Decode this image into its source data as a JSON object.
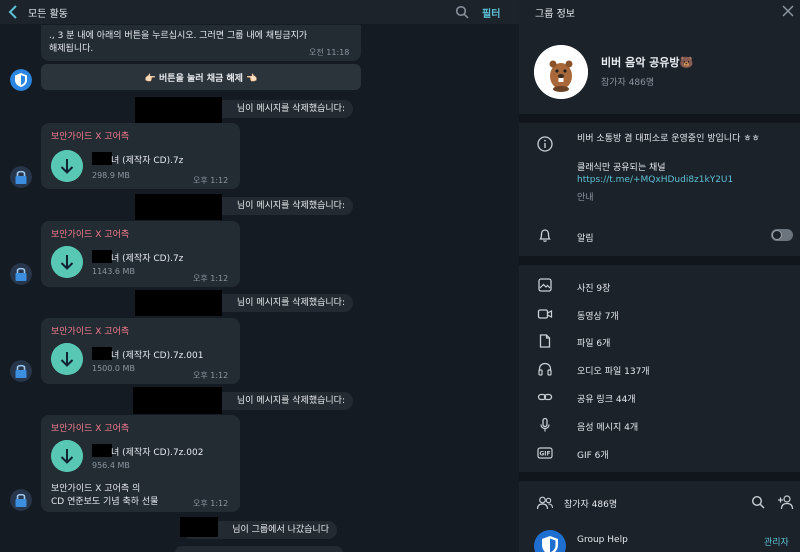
{
  "chat": {
    "header": {
      "title": "모든 활동",
      "filter_label": "필터"
    },
    "top_message": {
      "line1": "., 3 분 내에 아래의 버튼을 누르십시오. 그러면 그룹 내에 채팅금지가",
      "line2": "해제됩니다.",
      "time": "오전 11:18"
    },
    "unban_button": {
      "label": "👉🏻 버튼을 눌러 채금 해제 👈🏻"
    },
    "system_messages": [
      {
        "text": "님이 메시지를 삭제했습니다:"
      },
      {
        "text": "님이 메시지를 삭제했습니다:"
      },
      {
        "text": "님이 메시지를 삭제했습니다:"
      },
      {
        "text": "님이 메시지를 삭제했습니다:"
      },
      {
        "text": "님이 그룹에서 나갔습니다"
      }
    ],
    "file_messages": [
      {
        "sender": "보안가이드 X 고어측",
        "filename": "녀 (제작자 CD).7z",
        "size": "298.9 MB",
        "time": "오후 1:12"
      },
      {
        "sender": "보안가이드 X 고어측",
        "filename": "녀 (제작자 CD).7z",
        "size": "1143.6 MB",
        "time": "오후 1:12"
      },
      {
        "sender": "보안가이드 X 고어측",
        "filename": "녀 (제작자 CD).7z.001",
        "size": "1500.0 MB",
        "time": "오후 1:12"
      },
      {
        "sender": "보안가이드 X 고어측",
        "filename": "녀 (제작자 CD).7z.002",
        "size": "956.4 MB",
        "time": "오후 1:12",
        "caption1": "보안가이드 X 고어측 의",
        "caption2": "CD 연준보도 기념 축하 선물"
      }
    ]
  },
  "info": {
    "title": "그룹 정보",
    "group_name": "비버 음악 공유방🐻",
    "member_count": "참가자 486명",
    "description": {
      "line1": "비버 소통방 겸 대피소로 운영중인 방입니다 ㅎㅎ",
      "line2": "클래식만 공유되는 채널",
      "link": "https://t.me/+MQxHDudi8z1kY2U1",
      "sublabel": "안내"
    },
    "notifications_label": "알림",
    "notifications_on": false,
    "media": [
      {
        "icon": "photo-icon",
        "label": "사진 9장"
      },
      {
        "icon": "video-icon",
        "label": "동영상 7개"
      },
      {
        "icon": "file-icon",
        "label": "파일 6개"
      },
      {
        "icon": "audio-icon",
        "label": "오디오 파일 137개"
      },
      {
        "icon": "link-icon",
        "label": "공유 링크 44개"
      },
      {
        "icon": "voice-icon",
        "label": "음성 메시지 4개"
      },
      {
        "icon": "gif-icon",
        "label": "GIF 6개"
      }
    ],
    "members_header": "참가자 486명",
    "members": [
      {
        "name": "Group Help",
        "role": "관리자"
      }
    ]
  },
  "colors": {
    "accent": "#5cc1d6",
    "sender": "#f47b8d",
    "download": "#58c8b4",
    "bubble": "#232b33",
    "chat_bg": "#151b22",
    "panel_bg": "#1c2229"
  }
}
